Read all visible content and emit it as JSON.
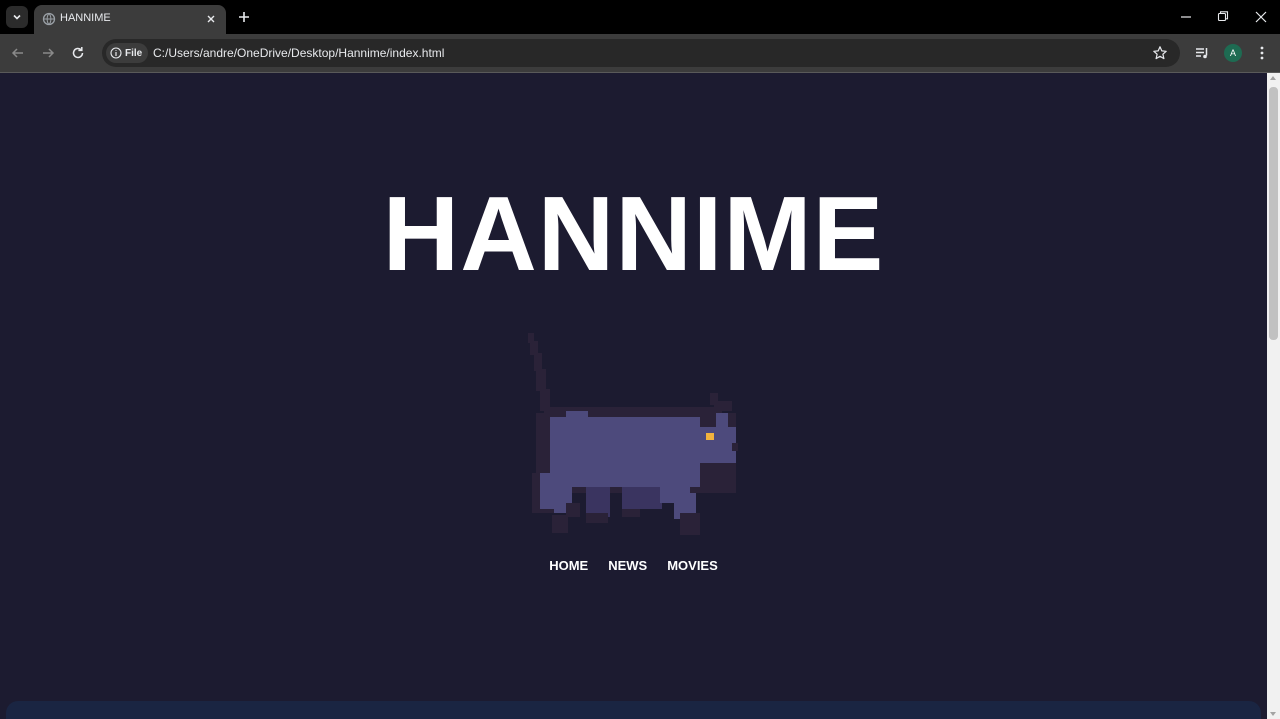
{
  "browser": {
    "tab": {
      "title": "HANNIME"
    },
    "address": {
      "chip_label": "File",
      "url": "C:/Users/andre/OneDrive/Desktop/Hannime/index.html"
    },
    "profile_initial": "A"
  },
  "page": {
    "brand": "HANNIME",
    "nav": [
      {
        "label": "HOME"
      },
      {
        "label": "NEWS"
      },
      {
        "label": "MOVIES"
      }
    ]
  },
  "colors": {
    "page_bg": "#1c1b30",
    "cat_body": "#4d4a7c",
    "cat_outline": "#2a2238",
    "cat_eye": "#f2b33d",
    "bottom_panel": "#1a2542"
  },
  "icons": [
    "tab-search-icon",
    "globe-icon",
    "close-icon",
    "plus-icon",
    "minimize-icon",
    "restore-icon",
    "window-close-icon",
    "back-icon",
    "forward-icon",
    "reload-icon",
    "info-icon",
    "star-icon",
    "media-queue-icon",
    "menu-dots-icon"
  ]
}
